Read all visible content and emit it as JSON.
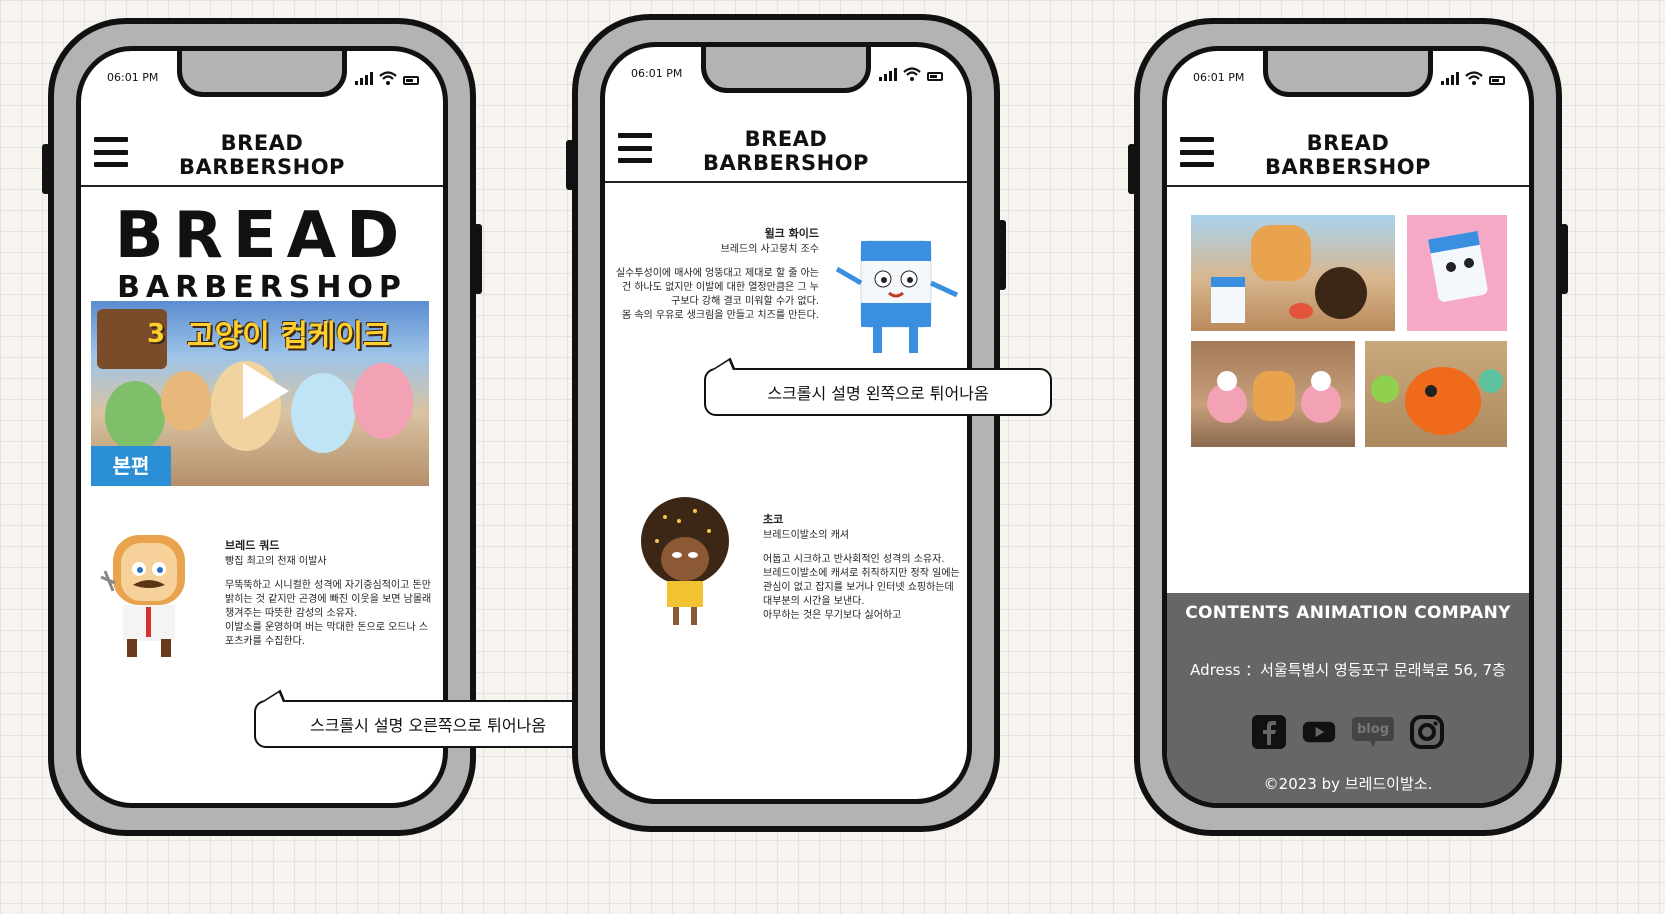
{
  "phone1": {
    "time": "06:01 PM",
    "header_title": [
      "BREAD",
      "BARBERSHOP"
    ],
    "logo": [
      "BREAD",
      "BARBERSHOP"
    ],
    "video": {
      "title": "고양이 컵케이크",
      "badge_number": "3",
      "tag": "본편"
    },
    "feature": {
      "name": "브레드 쿼드",
      "subtitle": "빵집 최고의 천재 이발사",
      "body": "무뚝뚝하고 시니컬한 성격에 자기중심적이고 돈만 밝히는 것 같지만 곤경에 빠진 이웃을 보면 남몰래 챙겨주는 따뜻한 감성의 소유자.\n이발소를 운영하며 버는 막대한 돈으로 오드나 스포츠카를 수집한다."
    },
    "bubble": "스크롤시 설명 오른쪽으로 튀어나옴"
  },
  "phone2": {
    "time": "06:01 PM",
    "header_title": [
      "BREAD",
      "BARBERSHOP"
    ],
    "feature1": {
      "name": "윌크 화이드",
      "subtitle": "브레드의 사고뭉치 조수",
      "body": "실수투성이에 매사에 엉뚱대고 제대로 할 줄 아는 건 하나도 없지만 이발에 대한 열정만큼은 그 누구보다 강해 결코 미워할 수가 없다.\n몸 속의 우유로 생크림을 만들고 치즈를 만든다."
    },
    "bubble": "스크롤시 설명 왼쪽으로 튀어나옴",
    "feature2": {
      "name": "초코",
      "subtitle": "브레드이발소의 캐셔",
      "body": "어둡고 시크하고 반사회적인 성격의 소유자.\n브레드이발소에 캐셔로 취직하지만 정작 일에는 관심이 없고 잡지를 보거나 인터넷 쇼핑하는데 대부분의 시간을 보낸다.\n아무하는 것은 무기보다 싫어하고"
    }
  },
  "phone3": {
    "time": "06:01 PM",
    "header_title": [
      "BREAD",
      "BARBERSHOP"
    ],
    "footer": {
      "company": "CONTENTS ANIMATION COMPANY",
      "address": "Adress ：서울특별시 영등포구 문래북로 56, 7층",
      "socials": [
        "facebook-icon",
        "youtube-icon",
        "blog-icon",
        "instagram-icon"
      ],
      "blog_label": "blog",
      "copyright": "©2023 by 브레드이발소."
    }
  },
  "colors": {
    "background": "#f7f3ee",
    "phone_frame": "#b3b3b3",
    "footer": "#666666",
    "video_tag": "#2b8fd6",
    "video_title": "#ffcf2e"
  }
}
